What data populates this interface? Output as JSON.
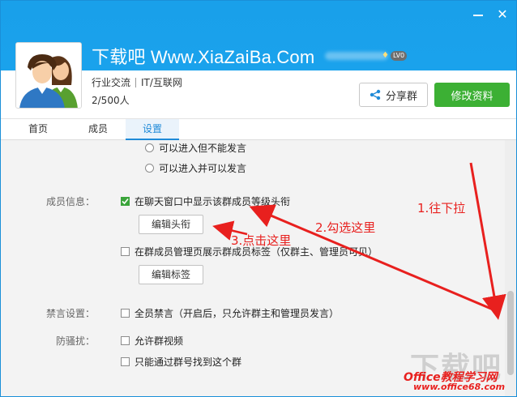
{
  "window": {
    "close_glyph": "✕"
  },
  "group": {
    "name": "下载吧 Www.XiaZaiBa.Com",
    "level": "LV0",
    "tags": [
      "行业交流",
      "IT/互联网"
    ],
    "member_count": "2/500人"
  },
  "actions": {
    "share": "分享群",
    "edit": "修改资料"
  },
  "tabs": [
    {
      "label": "首页",
      "active": false
    },
    {
      "label": "成员",
      "active": false
    },
    {
      "label": "设置",
      "active": true
    }
  ],
  "settings": {
    "radio_partial": "可以进入但不能发言",
    "radio_full": "可以进入并可以发言",
    "member_info": {
      "label": "成员信息：",
      "show_level_title": "在聊天窗口中显示该群成员等级头衔",
      "edit_title_btn": "编辑头衔",
      "show_tags": "在群成员管理页展示群成员标签（仅群主、管理员可见）",
      "edit_tags_btn": "编辑标签"
    },
    "mute": {
      "label": "禁言设置：",
      "mute_all": "全员禁言（开启后，只允许群主和管理员发言）"
    },
    "anti_harass": {
      "label": "防骚扰：",
      "allow_video": "允许群视频",
      "find_by_number": "只能通过群号找到这个群"
    }
  },
  "annotations": {
    "step1": "1.往下拉",
    "step2": "2.勾选这里",
    "step3": "3.点击这里"
  },
  "watermark": {
    "big": "下载吧",
    "line1": "Office教程学习网",
    "line2": "www.office68.com"
  },
  "colors": {
    "header_blue": "#1aa2ec",
    "accent_green": "#3cb034",
    "tab_active": "#1e8ad8",
    "annotation_red": "#e8201e"
  }
}
